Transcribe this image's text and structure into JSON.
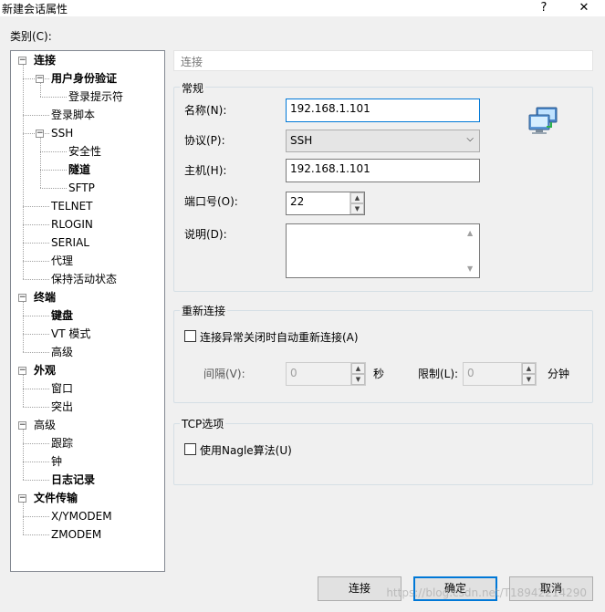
{
  "window": {
    "title": "新建会话属性",
    "help": "?",
    "close": "✕"
  },
  "category_label": "类别(C):",
  "tree": [
    {
      "label": "连接",
      "level": 0,
      "bold": true,
      "expander": "−"
    },
    {
      "label": "用户身份验证",
      "level": 1,
      "bold": true,
      "expander": "−"
    },
    {
      "label": "登录提示符",
      "level": 2,
      "bold": false
    },
    {
      "label": "登录脚本",
      "level": 1,
      "bold": false
    },
    {
      "label": "SSH",
      "level": 1,
      "bold": false,
      "expander": "−"
    },
    {
      "label": "安全性",
      "level": 2,
      "bold": false
    },
    {
      "label": "隧道",
      "level": 2,
      "bold": true
    },
    {
      "label": "SFTP",
      "level": 2,
      "bold": false
    },
    {
      "label": "TELNET",
      "level": 1,
      "bold": false
    },
    {
      "label": "RLOGIN",
      "level": 1,
      "bold": false
    },
    {
      "label": "SERIAL",
      "level": 1,
      "bold": false
    },
    {
      "label": "代理",
      "level": 1,
      "bold": false
    },
    {
      "label": "保持活动状态",
      "level": 1,
      "bold": false
    },
    {
      "label": "终端",
      "level": 0,
      "bold": true,
      "expander": "−"
    },
    {
      "label": "键盘",
      "level": 1,
      "bold": true
    },
    {
      "label": "VT 模式",
      "level": 1,
      "bold": false
    },
    {
      "label": "高级",
      "level": 1,
      "bold": false
    },
    {
      "label": "外观",
      "level": 0,
      "bold": true,
      "expander": "−"
    },
    {
      "label": "窗口",
      "level": 1,
      "bold": false
    },
    {
      "label": "突出",
      "level": 1,
      "bold": false
    },
    {
      "label": "高级",
      "level": 0,
      "bold": false,
      "expander": "−"
    },
    {
      "label": "跟踪",
      "level": 1,
      "bold": false
    },
    {
      "label": "钟",
      "level": 1,
      "bold": false
    },
    {
      "label": "日志记录",
      "level": 1,
      "bold": true
    },
    {
      "label": "文件传输",
      "level": 0,
      "bold": true,
      "expander": "−"
    },
    {
      "label": "X/YMODEM",
      "level": 1,
      "bold": false
    },
    {
      "label": "ZMODEM",
      "level": 1,
      "bold": false
    }
  ],
  "page_header": "连接",
  "general": {
    "title": "常规",
    "name_label": "名称(N):",
    "name_value": "192.168.1.101",
    "protocol_label": "协议(P):",
    "protocol_value": "SSH",
    "host_label": "主机(H):",
    "host_value": "192.168.1.101",
    "port_label": "端口号(O):",
    "port_value": "22",
    "desc_label": "说明(D):",
    "desc_value": ""
  },
  "reconnect": {
    "title": "重新连接",
    "auto_label": "连接异常关闭时自动重新连接(A)",
    "auto_checked": false,
    "interval_label": "间隔(V):",
    "interval_value": "0",
    "interval_unit": "秒",
    "limit_label": "限制(L):",
    "limit_value": "0",
    "limit_unit": "分钟"
  },
  "tcp": {
    "title": "TCP选项",
    "nagle_label": "使用Nagle算法(U)",
    "nagle_checked": false
  },
  "buttons": {
    "connect": "连接",
    "ok": "确定",
    "cancel": "取消"
  },
  "watermark": "https://blog.csdn.net/T18942214290"
}
